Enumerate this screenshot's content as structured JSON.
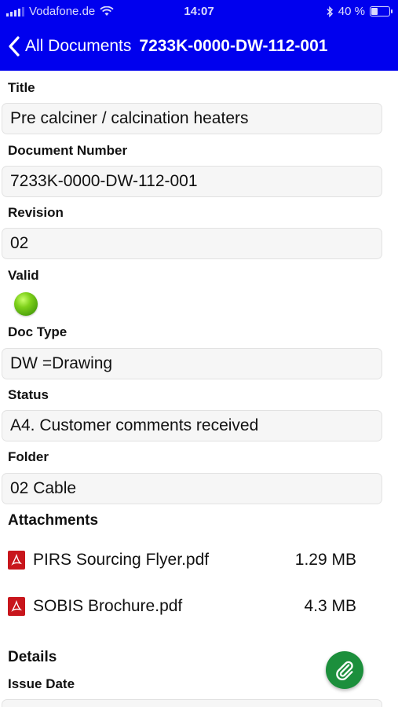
{
  "status_bar": {
    "carrier": "Vodafone.de",
    "time": "14:07",
    "battery": "40 %",
    "battery_level": 0.4
  },
  "nav": {
    "back_label": "All Documents",
    "title": "7233K-0000-DW-112-001"
  },
  "fields": {
    "title": {
      "label": "Title",
      "value": "Pre calciner / calcination heaters"
    },
    "document_number": {
      "label": "Document Number",
      "value": "7233K-0000-DW-112-001"
    },
    "revision": {
      "label": "Revision",
      "value": "02"
    },
    "valid": {
      "label": "Valid",
      "status_color": "#6cc11a"
    },
    "doc_type": {
      "label": "Doc Type",
      "value": "DW =Drawing"
    },
    "status": {
      "label": "Status",
      "value": "A4. Customer comments received"
    },
    "folder": {
      "label": "Folder",
      "value": "02 Cable"
    }
  },
  "attachments": {
    "heading": "Attachments",
    "items": [
      {
        "name": "PIRS Sourcing Flyer.pdf",
        "size": "1.29 MB",
        "icon": "pdf-icon"
      },
      {
        "name": "SOBIS Brochure.pdf",
        "size": "4.3 MB",
        "icon": "pdf-icon"
      }
    ]
  },
  "details": {
    "heading": "Details",
    "issue_date_label": "Issue Date",
    "attach_button_icon": "paperclip-icon"
  },
  "colors": {
    "header": "#0000ee",
    "pdf": "#c8161c",
    "fab": "#1c8f3c"
  }
}
